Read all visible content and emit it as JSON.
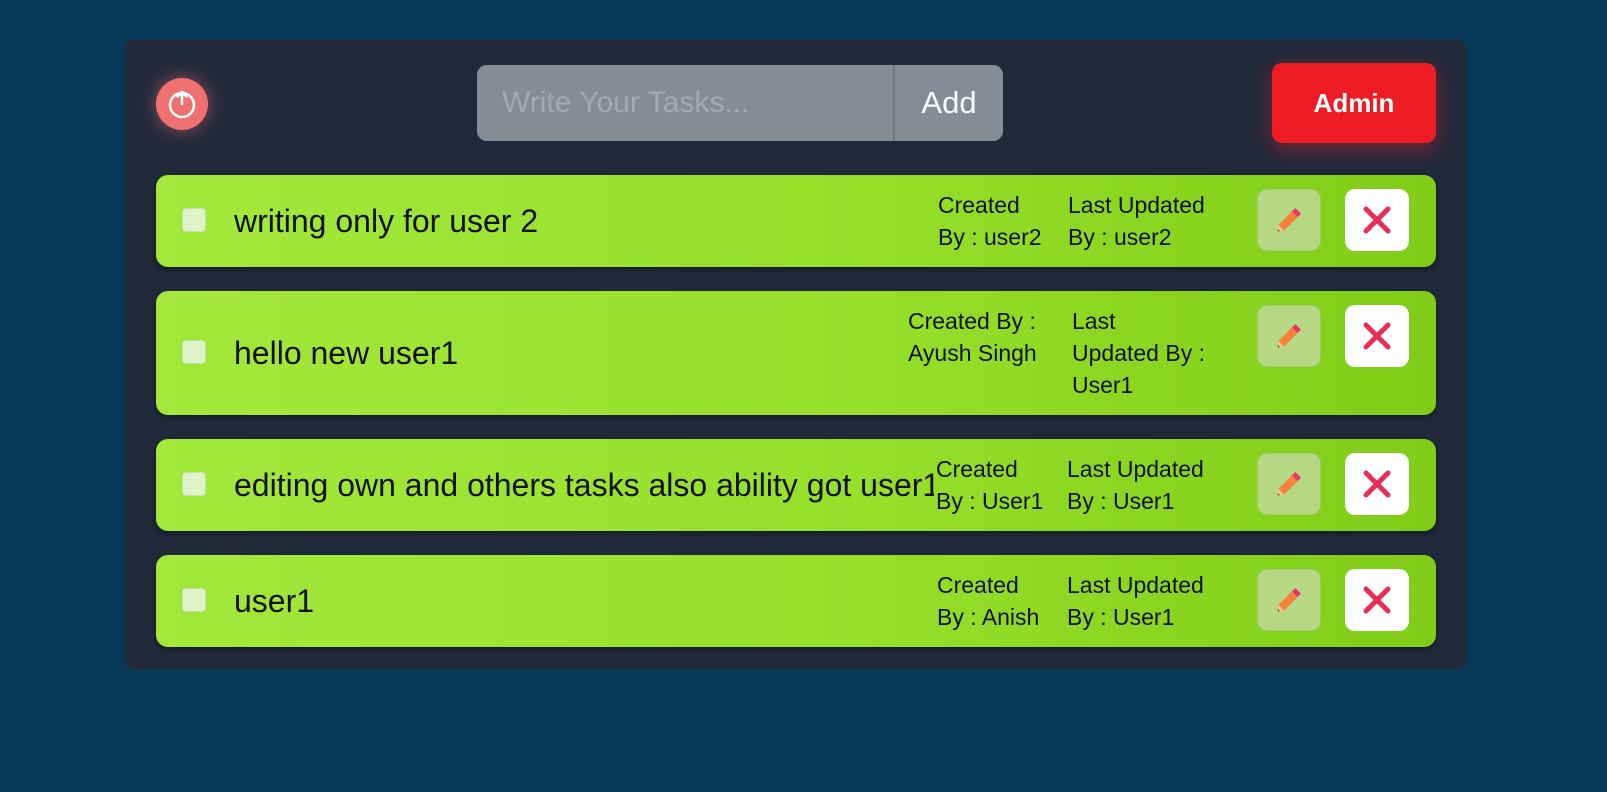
{
  "header": {
    "input_placeholder": "Write Your Tasks...",
    "add_label": "Add",
    "admin_label": "Admin"
  },
  "icons": {
    "power": "power-icon",
    "edit": "pencil-icon",
    "delete": "close-icon"
  },
  "colors": {
    "background": "#063a58",
    "panel": "#212a3b",
    "task_green": "#96df2b",
    "admin_red": "#ee1c25",
    "power_pink": "#f07070",
    "delete_x": "#ea2d56",
    "pencil_orange": "#f7813a"
  },
  "tasks": [
    {
      "title": "writing only for user 2",
      "created_line1": "Created",
      "created_line2": "By : user2",
      "updated_line1": "Last Updated",
      "updated_line2": "By : user2"
    },
    {
      "title": "hello new user1",
      "created_line1": "Created By :",
      "created_line2": "Ayush Singh",
      "updated_line1": "Last",
      "updated_line2": "Updated By :",
      "updated_line3": "User1"
    },
    {
      "title": "editing own and others tasks also ability got user1",
      "created_line1": "Created",
      "created_line2": "By : User1",
      "updated_line1": "Last Updated",
      "updated_line2": "By : User1"
    },
    {
      "title": "user1",
      "created_line1": "Created",
      "created_line2": "By : Anish",
      "updated_line1": "Last Updated",
      "updated_line2": "By : User1"
    }
  ]
}
